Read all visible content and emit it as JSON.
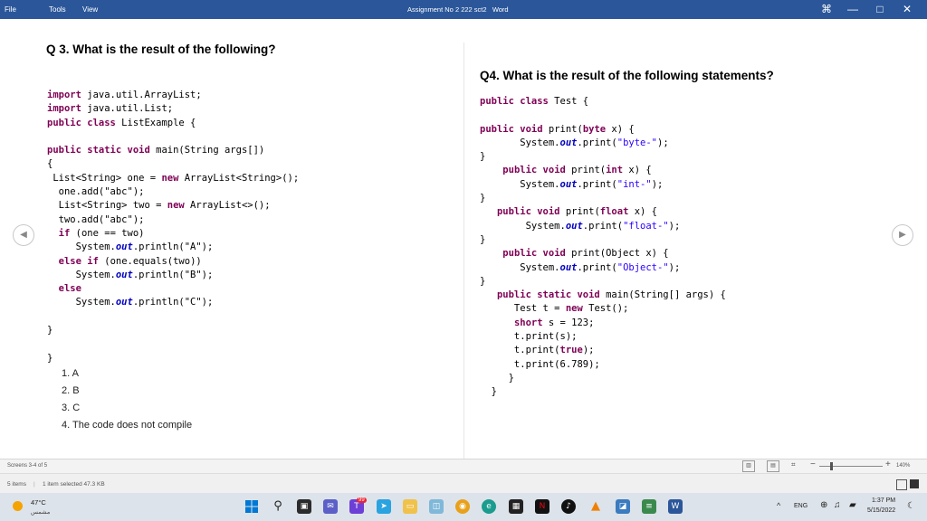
{
  "app": {
    "menu": [
      "File",
      "Tools",
      "View"
    ],
    "title": "Assignment No 2 222 sct2",
    "app_name": "Word",
    "controls": {
      "restore": "⌘",
      "minimize": "—",
      "maximize": "□",
      "close": "✕"
    }
  },
  "q3": {
    "title": "Q 3. What is the result of the following?",
    "code": [
      [
        {
          "t": "import",
          "c": "kw"
        },
        {
          "t": " java.util.ArrayList;"
        }
      ],
      [
        {
          "t": "import",
          "c": "kw"
        },
        {
          "t": " java.util.List;"
        }
      ],
      [
        {
          "t": "public class",
          "c": "kw"
        },
        {
          "t": " ListExample {"
        }
      ],
      [],
      [
        {
          "t": "public static void",
          "c": "kw"
        },
        {
          "t": " main(String args[])"
        }
      ],
      [
        {
          "t": "{"
        }
      ],
      [
        {
          "t": " List<String> one = "
        },
        {
          "t": "new",
          "c": "kw"
        },
        {
          "t": " ArrayList<String>();"
        }
      ],
      [
        {
          "t": "  one.add(\"abc\");"
        }
      ],
      [
        {
          "t": "  List<String> two = "
        },
        {
          "t": "new",
          "c": "kw"
        },
        {
          "t": " ArrayList<>();"
        }
      ],
      [
        {
          "t": "  two.add(\"abc\");"
        }
      ],
      [
        {
          "t": "  "
        },
        {
          "t": "if",
          "c": "kw"
        },
        {
          "t": " (one == two)"
        }
      ],
      [
        {
          "t": "     System."
        },
        {
          "t": "out",
          "c": "fld"
        },
        {
          "t": ".println(\"A\");"
        }
      ],
      [
        {
          "t": "  "
        },
        {
          "t": "else if",
          "c": "kw"
        },
        {
          "t": " (one.equals(two))"
        }
      ],
      [
        {
          "t": "     System."
        },
        {
          "t": "out",
          "c": "fld"
        },
        {
          "t": ".println(\"B\");"
        }
      ],
      [
        {
          "t": "  "
        },
        {
          "t": "else",
          "c": "kw"
        }
      ],
      [
        {
          "t": "     System."
        },
        {
          "t": "out",
          "c": "fld"
        },
        {
          "t": ".println(\"C\");"
        }
      ],
      [],
      [
        {
          "t": "}"
        }
      ],
      [],
      [
        {
          "t": "}"
        }
      ]
    ],
    "options": [
      "1. A",
      "2. B",
      "3. C",
      "4. The code does not compile"
    ]
  },
  "q4": {
    "title": "Q4. What is the result of the following statements?",
    "code": [
      [
        {
          "t": "public class",
          "c": "kw"
        },
        {
          "t": " Test {"
        }
      ],
      [],
      [
        {
          "t": "public void",
          "c": "kw"
        },
        {
          "t": " print("
        },
        {
          "t": "byte",
          "c": "kw"
        },
        {
          "t": " x) {"
        }
      ],
      [
        {
          "t": "       System."
        },
        {
          "t": "out",
          "c": "fld"
        },
        {
          "t": ".print("
        },
        {
          "t": "\"byte-\"",
          "c": "str"
        },
        {
          "t": ");"
        }
      ],
      [
        {
          "t": "}"
        }
      ],
      [
        {
          "t": "    "
        },
        {
          "t": "public void",
          "c": "kw"
        },
        {
          "t": " print("
        },
        {
          "t": "int",
          "c": "kw"
        },
        {
          "t": " x) {"
        }
      ],
      [
        {
          "t": "       System."
        },
        {
          "t": "out",
          "c": "fld"
        },
        {
          "t": ".print("
        },
        {
          "t": "\"int-\"",
          "c": "str"
        },
        {
          "t": ");"
        }
      ],
      [
        {
          "t": "}"
        }
      ],
      [
        {
          "t": "   "
        },
        {
          "t": "public void",
          "c": "kw"
        },
        {
          "t": " print("
        },
        {
          "t": "float",
          "c": "kw"
        },
        {
          "t": " x) {"
        }
      ],
      [
        {
          "t": "        System."
        },
        {
          "t": "out",
          "c": "fld"
        },
        {
          "t": ".print("
        },
        {
          "t": "\"float-\"",
          "c": "str"
        },
        {
          "t": ");"
        }
      ],
      [
        {
          "t": "}"
        }
      ],
      [
        {
          "t": "    "
        },
        {
          "t": "public void",
          "c": "kw"
        },
        {
          "t": " print(Object x) {"
        }
      ],
      [
        {
          "t": "       System."
        },
        {
          "t": "out",
          "c": "fld"
        },
        {
          "t": ".print("
        },
        {
          "t": "\"Object-\"",
          "c": "str"
        },
        {
          "t": ");"
        }
      ],
      [
        {
          "t": "}"
        }
      ],
      [
        {
          "t": "   "
        },
        {
          "t": "public static void",
          "c": "kw"
        },
        {
          "t": " main(String[] args) {"
        }
      ],
      [
        {
          "t": "      Test t = "
        },
        {
          "t": "new",
          "c": "kw"
        },
        {
          "t": " Test();"
        }
      ],
      [
        {
          "t": "      "
        },
        {
          "t": "short",
          "c": "kw"
        },
        {
          "t": " s = 123;"
        }
      ],
      [
        {
          "t": "      t.print(s);"
        }
      ],
      [
        {
          "t": "      t.print("
        },
        {
          "t": "true",
          "c": "kw"
        },
        {
          "t": ");"
        }
      ],
      [
        {
          "t": "      t.print(6.789);"
        }
      ],
      [
        {
          "t": "     }"
        }
      ],
      [
        {
          "t": "  }"
        }
      ]
    ]
  },
  "status": {
    "screens": "Screens 3-4 of 5",
    "zoom": "140%"
  },
  "explorer": {
    "items": "5 items",
    "selected": "1 item selected  47.3 KB"
  },
  "taskbar": {
    "weather_temp": "47°C",
    "weather_desc": "مشمس",
    "lang": "ENG",
    "time": "1:37 PM",
    "date": "5/15/2022",
    "badge": "99"
  },
  "colors": {
    "titlebar": "#2b579a",
    "keyword": "#7f0055",
    "field": "#0000c0",
    "string": "#2a00ff"
  }
}
